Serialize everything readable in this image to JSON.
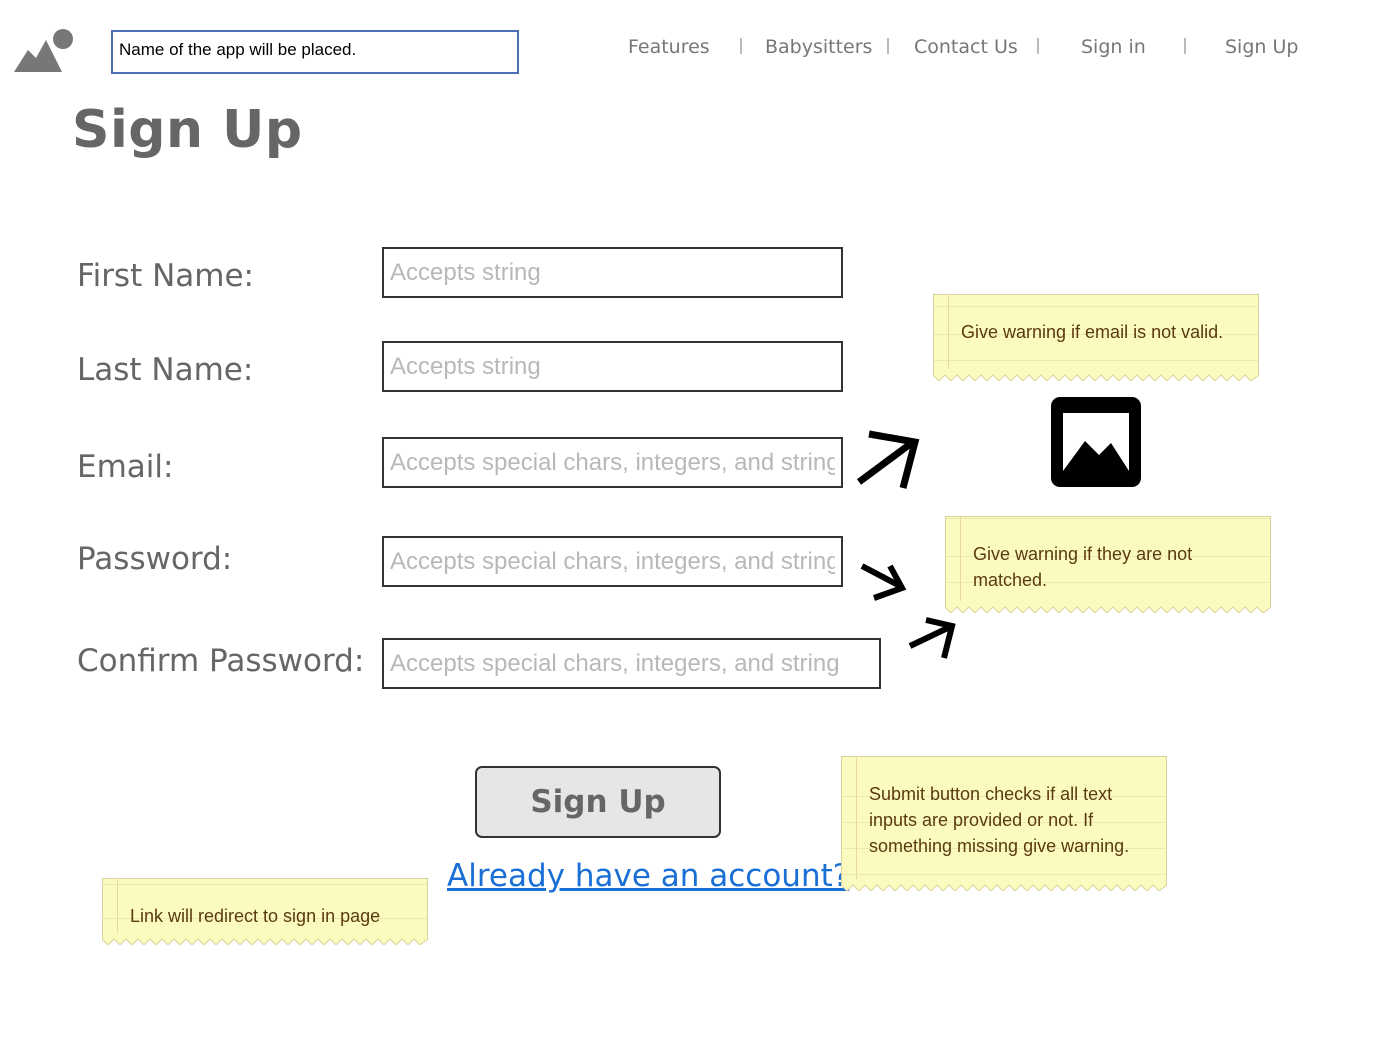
{
  "header": {
    "app_name": "Name of the app will be placed.",
    "logo_icon": "image-mountain-icon",
    "nav": [
      {
        "label": "Features"
      },
      {
        "label": "Babysitters"
      },
      {
        "label": "Contact Us"
      },
      {
        "label": "Sign in"
      },
      {
        "label": "Sign Up"
      }
    ]
  },
  "page": {
    "title": "Sign Up"
  },
  "form": {
    "fields": [
      {
        "label": "First Name:",
        "placeholder": "Accepts string"
      },
      {
        "label": "Last Name:",
        "placeholder": "Accepts string"
      },
      {
        "label": "Email:",
        "placeholder": "Accepts special chars, integers, and string"
      },
      {
        "label": "Password:",
        "placeholder": "Accepts special chars, integers, and string"
      },
      {
        "label": "Confirm Password:",
        "placeholder": "Accepts special chars, integers, and string"
      }
    ],
    "submit_label": "Sign Up",
    "account_link": "Already have an account?"
  },
  "notes": {
    "email": "Give warning if email is not valid.",
    "password": "Give warning if they are not matched.",
    "submit": "Submit button checks if all text inputs are provided or not. If something missing give warning.",
    "link": "Link will redirect to sign in page"
  },
  "icons": {
    "placeholder_image": "image-icon",
    "arrows": "arrow-icon"
  },
  "colors": {
    "link": "#1a6fd6",
    "note_bg": "#fcfbbf",
    "app_name_border": "#4a6fb5"
  }
}
